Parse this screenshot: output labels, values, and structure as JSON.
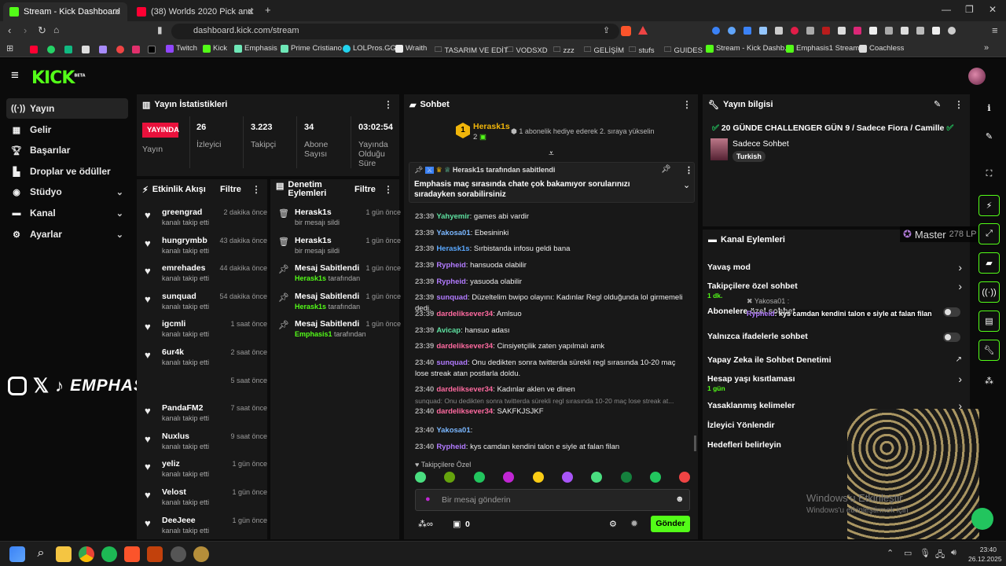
{
  "browser": {
    "tabs": [
      {
        "title": "Stream - Kick Dashboard"
      },
      {
        "title": "(38) Worlds 2020 Pick and Ban musi..."
      }
    ],
    "url": "dashboard.kick.com/stream",
    "bookmarks": [
      "Twitch",
      "Kick",
      "Emphasis",
      "Prime Cristiano",
      "LOLPros.GG",
      "Wraith",
      "TASARIM VE EDİT",
      "VODSXD",
      "zzz",
      "GELİŞİM",
      "stufs",
      "GUIDES",
      "Stream - Kick Dashb...",
      "Emphasis1 Stream",
      "Coachless"
    ]
  },
  "sidebar": {
    "logo": "KICK",
    "logo_sup": "BETA",
    "items": [
      {
        "label": "Yayın",
        "icon": "broadcast-icon"
      },
      {
        "label": "Gelir",
        "icon": "revenue-icon"
      },
      {
        "label": "Başarılar",
        "icon": "trophy-icon"
      },
      {
        "label": "Droplar ve ödüller",
        "icon": "drops-icon"
      },
      {
        "label": "Stüdyo",
        "icon": "studio-icon"
      },
      {
        "label": "Kanal",
        "icon": "channel-icon"
      },
      {
        "label": "Ayarlar",
        "icon": "settings-icon"
      }
    ]
  },
  "stats": {
    "title": "Yayın İstatistikleri",
    "live_badge": "YAYINDA",
    "live_label": "Yayın",
    "items": [
      {
        "value": "26",
        "label": "İzleyici"
      },
      {
        "value": "3.223",
        "label": "Takipçi"
      },
      {
        "value": "34",
        "label": "Abone Sayısı"
      },
      {
        "value": "03:02:54",
        "label": "Yayında Olduğu Süre"
      }
    ]
  },
  "activity": {
    "title": "Etkinlik Akışı",
    "filter": "Filtre",
    "events": [
      {
        "name": "greengrad",
        "sub": "kanalı takip etti",
        "time": "2 dakika önce"
      },
      {
        "name": "hungrymbb",
        "sub": "kanalı takip etti",
        "time": "43 dakika önce"
      },
      {
        "name": "emrehades",
        "sub": "kanalı takip etti",
        "time": "44 dakika önce"
      },
      {
        "name": "sunquad",
        "sub": "kanalı takip etti",
        "time": "54 dakika önce"
      },
      {
        "name": "igcmli",
        "sub": "kanalı takip etti",
        "time": "1 saat önce"
      },
      {
        "name": "6ur4k",
        "sub": "kanalı takip etti",
        "time": "2 saat önce"
      },
      {
        "name": "",
        "sub": "",
        "time": "5 saat önce"
      },
      {
        "name": "PandaFM2",
        "sub": "kanalı takip etti",
        "time": "7 saat önce"
      },
      {
        "name": "Nuxlus",
        "sub": "kanalı takip etti",
        "time": "9 saat önce"
      },
      {
        "name": "yeliz",
        "sub": "kanalı takip etti",
        "time": "1 gün önce"
      },
      {
        "name": "Velost",
        "sub": "kanalı takip etti",
        "time": "1 gün önce"
      },
      {
        "name": "DeeJeee",
        "sub": "kanalı takip etti",
        "time": "1 gün önce"
      }
    ]
  },
  "moderation": {
    "title": "Denetim Eylemleri",
    "filter": "Filtre",
    "items": [
      {
        "name": "Herask1s",
        "sub": "bir mesajı sildi",
        "by": "",
        "time": "1 gün önce",
        "icon": "trash-icon"
      },
      {
        "name": "Herask1s",
        "sub": "bir mesajı sildi",
        "by": "",
        "time": "1 gün önce",
        "icon": "trash-icon"
      },
      {
        "name": "Mesaj Sabitlendi",
        "sub": "tarafından",
        "by": "Herask1s",
        "time": "1 gün önce",
        "icon": "pin-icon"
      },
      {
        "name": "Mesaj Sabitlendi",
        "sub": "tarafından",
        "by": "Herask1s",
        "time": "1 gün önce",
        "icon": "pin-icon"
      },
      {
        "name": "Mesaj Sabitlendi",
        "sub": "tarafından",
        "by": "Emphasis1",
        "time": "1 gün önce",
        "icon": "pin-icon"
      }
    ]
  },
  "overlay": {
    "social": "EMPHASISLOL"
  },
  "chat": {
    "title": "Sohbet",
    "top_gifter": {
      "rank": "1",
      "name": "Herask1s",
      "count": "2",
      "note": "1 abonelik hediye ederek 2. sıraya yükselin"
    },
    "pinned": {
      "by_line": "Herask1s tarafından sabitlendi",
      "by_user": "Herask1s",
      "text": "Emphasis maç sırasında chate çok bakamıyor sorularınızı sıradayken sorabilirsiniz"
    },
    "messages": [
      {
        "time": "23:39",
        "user": "Yahyemir",
        "color": "#5ee0a0",
        "text": "games abi vardir"
      },
      {
        "time": "23:39",
        "user": "Yakosa01",
        "color": "#7ab7ff",
        "text": "Ebesininki"
      },
      {
        "time": "23:39",
        "user": "Herask1s",
        "color": "#5aa8ff",
        "text": "Sırbistanda infosu geldi bana"
      },
      {
        "time": "23:39",
        "user": "Rypheid",
        "color": "#b27bff",
        "text": "hansuoda olabilir"
      },
      {
        "time": "23:39",
        "user": "Rypheid",
        "color": "#b27bff",
        "text": "yasuoda olabilir"
      },
      {
        "time": "23:39",
        "user": "sunquad",
        "color": "#b27bff",
        "text": "Düzeltelim bwipo olayını: Kadınlar Regl olduğunda lol girmemeli dedi."
      },
      {
        "time": "23:39",
        "user": "dardeliksever34",
        "color": "#ff6aa0",
        "text": "Amlsuo"
      },
      {
        "time": "23:39",
        "user": "Avicap",
        "color": "#5ee0a0",
        "text": "hansuo adası"
      },
      {
        "time": "23:39",
        "user": "dardeliksever34",
        "color": "#ff6aa0",
        "text": "Cinsiyetçilik zaten yapılmalı amk"
      },
      {
        "time": "23:40",
        "user": "sunquad",
        "color": "#b27bff",
        "text": "Onu dedikten sonra twitterda sürekli regl sırasında 10-20 maç lose streak atan postlarla doldu."
      },
      {
        "time": "23:40",
        "user": "dardeliksever34",
        "color": "#ff6aa0",
        "text": "Kadınlar aklen ve dinen"
      },
      {
        "time": "23:40",
        "user": "dardeliksever34",
        "color": "#ff6aa0",
        "text": "SAKFKJSJKF",
        "reply": "sunquad: Onu dedikten sonra twitterda sürekli regl sırasında 10-20 maç lose streak at..."
      },
      {
        "time": "23:40",
        "user": "Yakosa01",
        "color": "#7ab7ff",
        "text": ""
      },
      {
        "time": "23:40",
        "user": "Rypheid",
        "color": "#b27bff",
        "text": "kys camdan kendini talon e siyle at falan filan"
      }
    ],
    "followers_only": "Takipçilere Özel",
    "input_placeholder": "Bir mesaj gönderin",
    "points": "0",
    "send": "Gönder"
  },
  "stream_info": {
    "title": "Yayın bilgisi",
    "stream_title": "20 GÜNDE CHALLENGER GÜN 9 / Sadece Fiora / Camille",
    "category": "Sadece Sohbet",
    "tag": "Turkish"
  },
  "channel_actions": {
    "title": "Kanal Eylemleri",
    "items": [
      {
        "label": "Yavaş mod",
        "sub": "",
        "control": "chevron"
      },
      {
        "label": "Takipçilere özel sohbet",
        "sub": "1 dk.",
        "control": "chevron"
      },
      {
        "label": "Abonelere özel sohbet",
        "sub": "",
        "control": "toggle"
      },
      {
        "label": "Yalnızca ifadelerle sohbet",
        "sub": "",
        "control": "toggle"
      },
      {
        "label": "Yapay Zeka ile Sohbet Denetimi",
        "sub": "",
        "control": "external"
      },
      {
        "label": "Hesap yaşı kısıtlaması",
        "sub": "1 gün",
        "control": "chevron"
      },
      {
        "label": "Yasaklanmış kelimeler",
        "sub": "",
        "control": "chevron"
      },
      {
        "label": "İzleyici Yönlendir",
        "sub": "",
        "control": "none"
      },
      {
        "label": "Hedefleri belirleyin",
        "sub": "",
        "control": "chevron"
      }
    ]
  },
  "overlays": {
    "rank": "Master",
    "lp": "278 LP",
    "ghost1": "Yakosa01 :",
    "ghost2_user": "Rypheid",
    "ghost2_text": ": kys camdan kendini talon e siyle at falan filan",
    "windows1": "Windows'u Etkinleştir",
    "windows2": "Windows'u etkinleştirmek için"
  },
  "taskbar": {
    "time": "23:40",
    "date": "26.12.2025"
  },
  "colors": {
    "accent": "#53fc18",
    "live": "#e9113c",
    "bg": "#0b0b0b",
    "panel": "#181818"
  }
}
